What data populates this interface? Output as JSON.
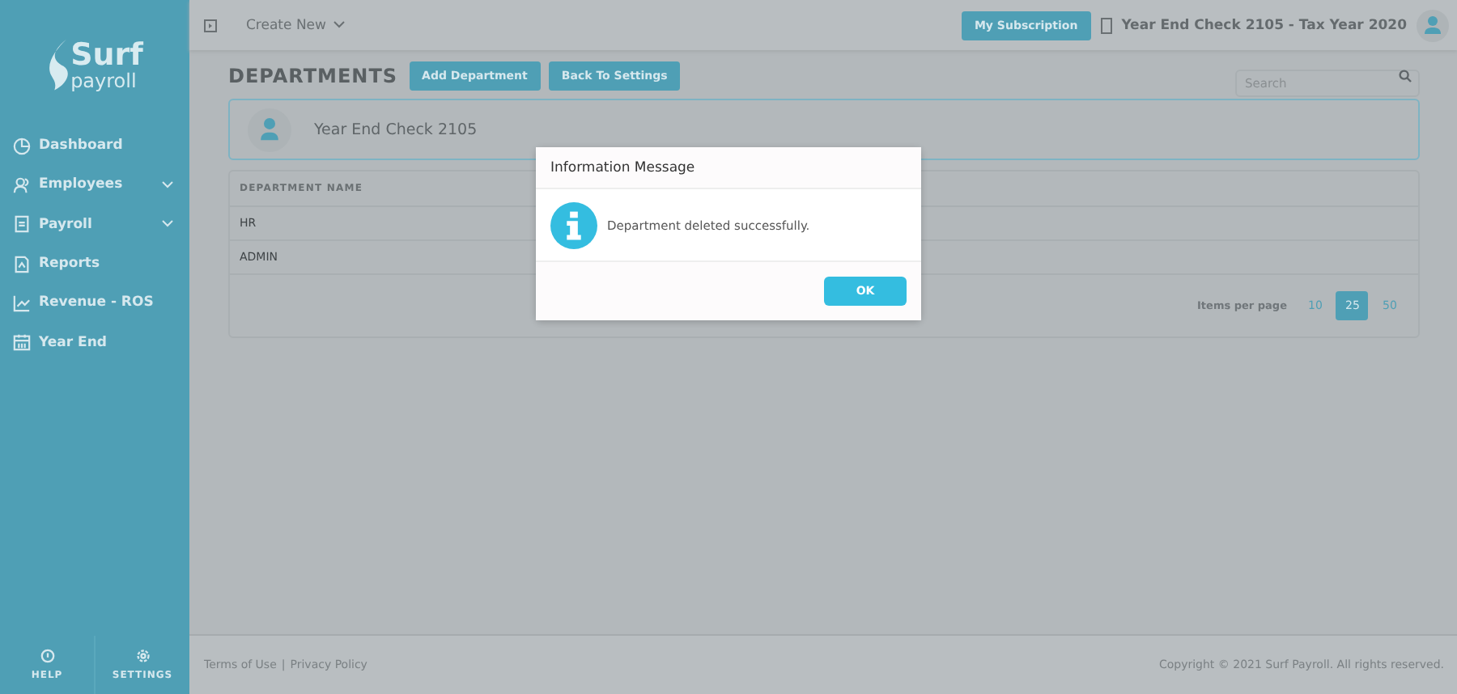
{
  "sidebar": {
    "logo": {
      "word": "Surf",
      "sub": "payroll"
    },
    "items": [
      {
        "label": "Dashboard",
        "submenu": false
      },
      {
        "label": "Employees",
        "submenu": true
      },
      {
        "label": "Payroll",
        "submenu": true
      },
      {
        "label": "Reports",
        "submenu": false
      },
      {
        "label": "Revenue - ROS",
        "submenu": false
      },
      {
        "label": "Year End",
        "submenu": false
      }
    ],
    "bottom": [
      {
        "label": "HELP"
      },
      {
        "label": "SETTINGS"
      }
    ]
  },
  "topbar": {
    "create": "Create New",
    "subscription": "My Subscription",
    "company": "Year End Check 2105 - Tax Year 2020"
  },
  "page": {
    "title": "DEPARTMENTS",
    "buttons": [
      "Add Department",
      "Back To Settings"
    ],
    "search": {
      "placeholder": "Search"
    },
    "company": "Year End Check 2105"
  },
  "table": {
    "columns": [
      "DEPARTMENT NAME"
    ],
    "rows": [
      [
        "HR"
      ],
      [
        "ADMIN"
      ]
    ],
    "pager": {
      "label": "Items per page",
      "options": [
        {
          "label": "10",
          "selected": false
        },
        {
          "label": "25",
          "selected": true
        },
        {
          "label": "50",
          "selected": false
        }
      ]
    }
  },
  "footer": {
    "links": [
      "Terms of Use",
      "Privacy Policy"
    ],
    "separator": "|",
    "copyright": "Copyright © 2021 Surf Payroll. All rights reserved."
  },
  "dialog": {
    "title": "Information Message",
    "message": "Department deleted successfully.",
    "button": "OK"
  }
}
